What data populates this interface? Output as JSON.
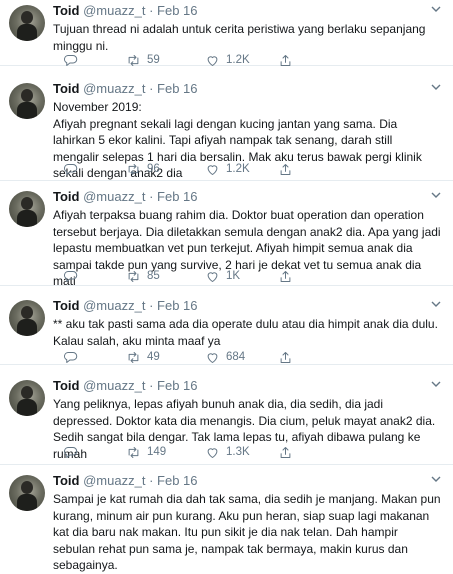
{
  "tweets": [
    {
      "name": "Toid",
      "handle": "@muazz_t",
      "dot": "·",
      "date": "Feb 16",
      "text": "Tujuan thread ni adalah untuk cerita peristiwa yang berlaku sepanjang minggu ni.",
      "retweets": "59",
      "likes": "1.2K"
    },
    {
      "name": "Toid",
      "handle": "@muazz_t",
      "dot": "·",
      "date": "Feb 16",
      "text": "November 2019:\nAfiyah pregnant sekali lagi dengan kucing jantan yang sama. Dia lahirkan 5 ekor kalini. Tapi afiyah nampak tak senang, darah still mengalir selepas 1 hari dia bersalin. Mak aku terus bawak pergi klinik sekali dengan anak2 dia",
      "retweets": "96",
      "likes": "1.2K"
    },
    {
      "name": "Toid",
      "handle": "@muazz_t",
      "dot": "·",
      "date": "Feb 16",
      "text": "Afiyah terpaksa buang rahim dia. Doktor buat operation dan operation tersebut berjaya. Dia diletakkan semula dengan anak2 dia. Apa yang jadi lepastu membuatkan vet pun terkejut. Afiyah himpit semua anak dia sampai takde pun yang survive, 2 hari je dekat vet tu semua anak dia mati",
      "retweets": "85",
      "likes": "1K"
    },
    {
      "name": "Toid",
      "handle": "@muazz_t",
      "dot": "·",
      "date": "Feb 16",
      "text": "** aku tak pasti sama ada dia operate dulu atau dia himpit anak dia dulu. Kalau salah, aku minta maaf ya",
      "retweets": "49",
      "likes": "684"
    },
    {
      "name": "Toid",
      "handle": "@muazz_t",
      "dot": "·",
      "date": "Feb 16",
      "text": "Yang peliknya, lepas afiyah bunuh anak dia, dia sedih, dia jadi depressed. Doktor kata dia menangis. Dia cium, peluk mayat anak2 dia. Sedih sangat bila dengar. Tak lama lepas tu, afiyah dibawa pulang ke rumah",
      "retweets": "149",
      "likes": "1.3K"
    },
    {
      "name": "Toid",
      "handle": "@muazz_t",
      "dot": "·",
      "date": "Feb 16",
      "text": "Sampai je kat rumah dia dah tak sama, dia sedih je manjang. Makan pun kurang, minum air pun kurang. Aku pun heran, siap suap lagi makanan kat dia baru nak makan. Itu pun sikit je dia nak telan. Dah hampir sebulan rehat pun sama je, nampak tak bermaya, makin kurus dan sebagainya.",
      "retweets": "",
      "likes": ""
    }
  ],
  "icons": {
    "reply": "reply-icon",
    "retweet": "retweet-icon",
    "like": "like-icon",
    "share": "share-icon",
    "menu": "chevron-down-icon"
  },
  "colors": {
    "text": "#14171a",
    "muted": "#657786",
    "divider": "#e6ecf0"
  }
}
